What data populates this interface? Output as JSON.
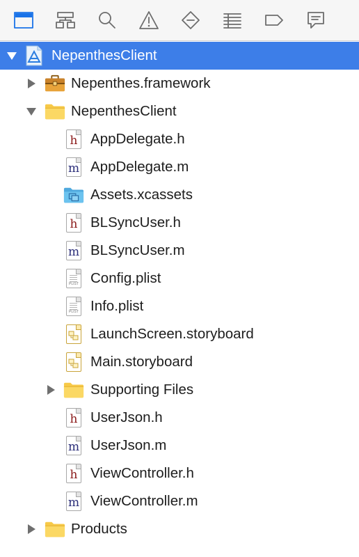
{
  "toolbar": {
    "buttons": [
      {
        "name": "project-navigator",
        "icon": "folder-icon",
        "active": true
      },
      {
        "name": "symbol-navigator",
        "icon": "hierarchy-icon",
        "active": false
      },
      {
        "name": "find-navigator",
        "icon": "search-icon",
        "active": false
      },
      {
        "name": "issue-navigator",
        "icon": "warning-icon",
        "active": false
      },
      {
        "name": "test-navigator",
        "icon": "diamond-minus-icon",
        "active": false
      },
      {
        "name": "debug-navigator",
        "icon": "list-icon",
        "active": false
      },
      {
        "name": "breakpoint-navigator",
        "icon": "breakpoint-tag-icon",
        "active": false
      },
      {
        "name": "report-navigator",
        "icon": "speech-bubble-icon",
        "active": false
      }
    ],
    "active_color": "#1a73e8",
    "inactive_color": "#6d6d6d"
  },
  "tree": {
    "items": [
      {
        "label": "NepenthesClient",
        "icon": "xcode-project-icon",
        "depth": 0,
        "disclosure": "expanded",
        "selected": true
      },
      {
        "label": "Nepenthes.framework",
        "icon": "framework-toolbox-icon",
        "depth": 1,
        "disclosure": "collapsed",
        "selected": false
      },
      {
        "label": "NepenthesClient",
        "icon": "yellow-folder-icon",
        "depth": 1,
        "disclosure": "expanded",
        "selected": false
      },
      {
        "label": "AppDelegate.h",
        "icon": "header-file-icon",
        "depth": 2,
        "disclosure": "none",
        "selected": false
      },
      {
        "label": "AppDelegate.m",
        "icon": "objc-source-file-icon",
        "depth": 2,
        "disclosure": "none",
        "selected": false
      },
      {
        "label": "Assets.xcassets",
        "icon": "asset-catalog-folder-icon",
        "depth": 2,
        "disclosure": "none",
        "selected": false
      },
      {
        "label": "BLSyncUser.h",
        "icon": "header-file-icon",
        "depth": 2,
        "disclosure": "none",
        "selected": false
      },
      {
        "label": "BLSyncUser.m",
        "icon": "objc-source-file-icon",
        "depth": 2,
        "disclosure": "none",
        "selected": false
      },
      {
        "label": "Config.plist",
        "icon": "plist-file-icon",
        "depth": 2,
        "disclosure": "none",
        "selected": false
      },
      {
        "label": "Info.plist",
        "icon": "plist-file-icon",
        "depth": 2,
        "disclosure": "none",
        "selected": false
      },
      {
        "label": "LaunchScreen.storyboard",
        "icon": "storyboard-file-icon",
        "depth": 2,
        "disclosure": "none",
        "selected": false
      },
      {
        "label": "Main.storyboard",
        "icon": "storyboard-file-icon",
        "depth": 2,
        "disclosure": "none",
        "selected": false
      },
      {
        "label": "Supporting Files",
        "icon": "yellow-folder-icon",
        "depth": 2,
        "disclosure": "collapsed",
        "selected": false
      },
      {
        "label": "UserJson.h",
        "icon": "header-file-icon",
        "depth": 2,
        "disclosure": "none",
        "selected": false
      },
      {
        "label": "UserJson.m",
        "icon": "objc-source-file-icon",
        "depth": 2,
        "disclosure": "none",
        "selected": false
      },
      {
        "label": "ViewController.h",
        "icon": "header-file-icon",
        "depth": 2,
        "disclosure": "none",
        "selected": false
      },
      {
        "label": "ViewController.m",
        "icon": "objc-source-file-icon",
        "depth": 2,
        "disclosure": "none",
        "selected": false
      },
      {
        "label": "Products",
        "icon": "yellow-folder-icon",
        "depth": 1,
        "disclosure": "collapsed",
        "selected": false
      }
    ]
  },
  "colors": {
    "selection": "#3d7ee8",
    "header_letter": "#8b1a1a",
    "source_letter": "#2c2f7a",
    "folder_yellow": "#f7c948",
    "asset_folder_blue": "#6cc3ef"
  }
}
